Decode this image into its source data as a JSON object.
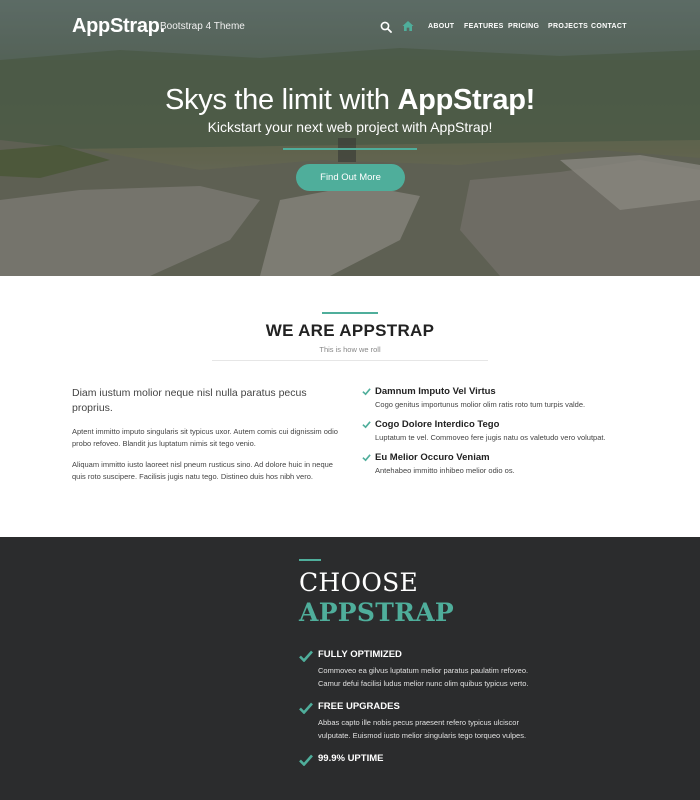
{
  "nav": {
    "logo_main": "AppStrap",
    "logo_dot": ".",
    "tagline": "Bootstrap 4 Theme",
    "links": [
      "ABOUT",
      "FEATURES",
      "PRICING",
      "PROJECTS",
      "CONTACT"
    ],
    "search_icon": "search-icon",
    "home_icon": "home-icon"
  },
  "hero": {
    "title_prefix": "Skys the limit with ",
    "title_strong": "AppStrap!",
    "subtitle": "Kickstart your next web project with AppStrap!",
    "button": "Find Out More"
  },
  "about": {
    "title": "WE ARE APPSTRAP",
    "subtitle": "This is how we roll",
    "lead": "Diam iustum molior neque nisl nulla paratus pecus proprius.",
    "paragraphs": [
      "Aptent immitto imputo singularis sit typicus uxor. Autem comis cui dignissim odio probo refoveo. Blandit jus luptatum nimis sit tego venio.",
      "Aliquam immitto iusto laoreet nisl pneum rusticus sino. Ad dolore huic in neque quis roto suscipere. Facilisis jugis natu tego. Distineo duis hos nibh vero."
    ],
    "features": [
      {
        "title": "Damnum Imputo Vel Virtus",
        "text": "Cogo genitus importunus molior olim ratis roto tum turpis valde."
      },
      {
        "title": "Cogo Dolore Interdico Tego",
        "text": "Luptatum te vel. Commoveo fere jugis natu os valetudo vero volutpat."
      },
      {
        "title": "Eu Melior Occuro Veniam",
        "text": "Antehabeo immitto inhibeo melior odio os."
      }
    ]
  },
  "choose": {
    "title_line1": "CHOOSE",
    "title_line2": "APPSTRAP",
    "items": [
      {
        "title": "FULLY OPTIMIZED",
        "text": "Commoveo ea gilvus luptatum melior paratus paulatim refoveo. Camur defui facilisi ludus melior nunc olim quibus typicus verto."
      },
      {
        "title": "FREE UPGRADES",
        "text": "Abbas capto ille nobis pecus praesent refero typicus ulciscor vulputate. Euismod iusto melior singularis tego torqueo vulpes."
      },
      {
        "title": "99.9% UPTIME",
        "text": ""
      }
    ]
  },
  "colors": {
    "accent": "#4fae9b",
    "dark_section": "#2b2c2d"
  }
}
